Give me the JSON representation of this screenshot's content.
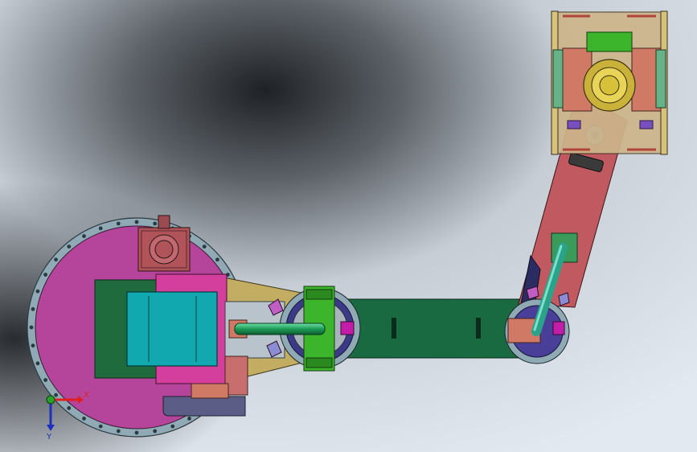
{
  "viewport": {
    "background_light": "#dfe6ee",
    "background_dark": "#2a2e33"
  },
  "triad": {
    "x_label": "X",
    "y_label": "Y",
    "x_color": "#e02020",
    "y_color": "#1c2fbf",
    "origin_color": "#2aa02a"
  },
  "colors": {
    "base_plate": "#b5459a",
    "base_flange": "#8fa9b5",
    "carriage": "#d43f9e",
    "dark_green": "#1f6b3e",
    "cyan_block": "#12a8b0",
    "motor_red": "#b0545a",
    "arm_green": "#196a40",
    "bright_green": "#3cb52c",
    "tan": "#c2ad63",
    "upper_arm_red": "#c05a60",
    "teal_rod": "#2aa38a",
    "salmon": "#d07a66",
    "navy": "#3b3a86",
    "gripper_tan": "#cdb58b",
    "yellow": "#d8c13a"
  }
}
